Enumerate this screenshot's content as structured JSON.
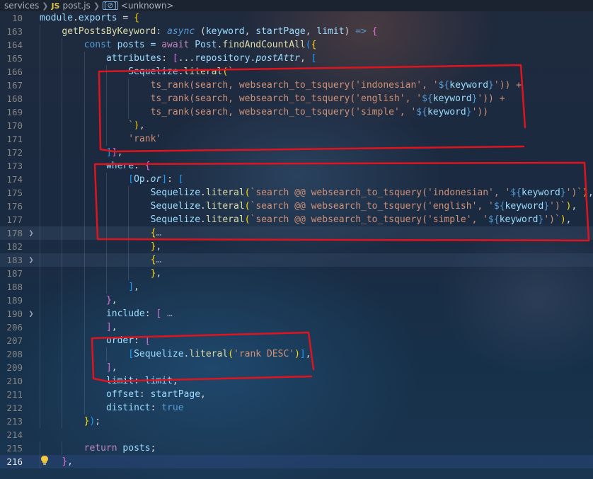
{
  "breadcrumb": {
    "folder": "services",
    "file_badge": "JS",
    "file": "post.js",
    "symbol_badge": "[⊘]",
    "symbol": "<unknown>"
  },
  "code_lines": [
    {
      "num": "10",
      "tokens": [
        {
          "t": "module",
          "c": "var"
        },
        {
          "t": ".",
          "c": "punc"
        },
        {
          "t": "exports",
          "c": "var"
        },
        {
          "t": " = ",
          "c": "punc"
        },
        {
          "t": "{",
          "c": "brk1"
        }
      ]
    },
    {
      "num": "163",
      "indent": 1,
      "tokens": [
        {
          "t": "getPostsByKeyword",
          "c": "fn"
        },
        {
          "t": ": ",
          "c": "punc"
        },
        {
          "t": "async",
          "c": "kwb it"
        },
        {
          "t": " (",
          "c": "punc"
        },
        {
          "t": "keyword",
          "c": "var"
        },
        {
          "t": ", ",
          "c": "punc"
        },
        {
          "t": "startPage",
          "c": "var"
        },
        {
          "t": ", ",
          "c": "punc"
        },
        {
          "t": "limit",
          "c": "var"
        },
        {
          "t": ") ",
          "c": "punc"
        },
        {
          "t": "=>",
          "c": "kwb"
        },
        {
          "t": " ",
          "c": "punc"
        },
        {
          "t": "{",
          "c": "brk2"
        }
      ]
    },
    {
      "num": "164",
      "indent": 2,
      "tokens": [
        {
          "t": "const",
          "c": "kwb"
        },
        {
          "t": " posts = ",
          "c": "var"
        },
        {
          "t": "await",
          "c": "kw"
        },
        {
          "t": " ",
          "c": "punc"
        },
        {
          "t": "Post",
          "c": "var"
        },
        {
          "t": ".",
          "c": "punc"
        },
        {
          "t": "findAndCountAll",
          "c": "fn"
        },
        {
          "t": "(",
          "c": "brk3"
        },
        {
          "t": "{",
          "c": "brk1"
        }
      ]
    },
    {
      "num": "165",
      "indent": 3,
      "tokens": [
        {
          "t": "attributes",
          "c": "prop"
        },
        {
          "t": ": ",
          "c": "punc"
        },
        {
          "t": "[",
          "c": "brk2"
        },
        {
          "t": "...",
          "c": "punc"
        },
        {
          "t": "repository",
          "c": "var"
        },
        {
          "t": ".",
          "c": "punc"
        },
        {
          "t": "postAttr",
          "c": "var it"
        },
        {
          "t": ", ",
          "c": "punc"
        },
        {
          "t": "[",
          "c": "brk3"
        }
      ]
    },
    {
      "num": "166",
      "indent": 4,
      "tokens": [
        {
          "t": "Sequelize",
          "c": "var"
        },
        {
          "t": ".",
          "c": "punc"
        },
        {
          "t": "literal",
          "c": "fn"
        },
        {
          "t": "(",
          "c": "brk1"
        },
        {
          "t": "`",
          "c": "tpl"
        }
      ]
    },
    {
      "num": "167",
      "indent": 5,
      "tokens": [
        {
          "t": "ts_rank(search, websearch_to_tsquery('indonesian', '",
          "c": "tpl"
        },
        {
          "t": "${",
          "c": "kwb"
        },
        {
          "t": "keyword",
          "c": "var"
        },
        {
          "t": "}",
          "c": "kwb"
        },
        {
          "t": "')) +",
          "c": "tpl"
        }
      ]
    },
    {
      "num": "168",
      "indent": 5,
      "tokens": [
        {
          "t": "ts_rank(search, websearch_to_tsquery('english', '",
          "c": "tpl"
        },
        {
          "t": "${",
          "c": "kwb"
        },
        {
          "t": "keyword",
          "c": "var"
        },
        {
          "t": "}",
          "c": "kwb"
        },
        {
          "t": "')) +",
          "c": "tpl"
        }
      ]
    },
    {
      "num": "169",
      "indent": 5,
      "tokens": [
        {
          "t": "ts_rank(search, websearch_to_tsquery('simple', '",
          "c": "tpl"
        },
        {
          "t": "${",
          "c": "kwb"
        },
        {
          "t": "keyword",
          "c": "var"
        },
        {
          "t": "}",
          "c": "kwb"
        },
        {
          "t": "'))",
          "c": "tpl"
        }
      ]
    },
    {
      "num": "170",
      "indent": 4,
      "tokens": [
        {
          "t": "`",
          "c": "tpl"
        },
        {
          "t": ")",
          "c": "brk1"
        },
        {
          "t": ",",
          "c": "punc"
        }
      ]
    },
    {
      "num": "171",
      "indent": 4,
      "tokens": [
        {
          "t": "'rank'",
          "c": "str"
        }
      ]
    },
    {
      "num": "172",
      "indent": 3,
      "tokens": [
        {
          "t": "]",
          "c": "brk3"
        },
        {
          "t": "]",
          "c": "brk2"
        },
        {
          "t": ",",
          "c": "punc"
        }
      ]
    },
    {
      "num": "173",
      "indent": 3,
      "tokens": [
        {
          "t": "where",
          "c": "prop"
        },
        {
          "t": ": ",
          "c": "punc"
        },
        {
          "t": "{",
          "c": "brk2"
        }
      ]
    },
    {
      "num": "174",
      "indent": 4,
      "tokens": [
        {
          "t": "[",
          "c": "brk3"
        },
        {
          "t": "Op",
          "c": "var"
        },
        {
          "t": ".",
          "c": "punc"
        },
        {
          "t": "or",
          "c": "var it"
        },
        {
          "t": "]",
          "c": "brk3"
        },
        {
          "t": ": ",
          "c": "punc"
        },
        {
          "t": "[",
          "c": "brk3"
        }
      ]
    },
    {
      "num": "175",
      "indent": 5,
      "tokens": [
        {
          "t": "Sequelize",
          "c": "var"
        },
        {
          "t": ".",
          "c": "punc"
        },
        {
          "t": "literal",
          "c": "fn"
        },
        {
          "t": "(",
          "c": "brk1"
        },
        {
          "t": "`search @@ websearch_to_tsquery('indonesian', '",
          "c": "tpl"
        },
        {
          "t": "${",
          "c": "kwb"
        },
        {
          "t": "keyword",
          "c": "var"
        },
        {
          "t": "}",
          "c": "kwb"
        },
        {
          "t": "')`",
          "c": "tpl"
        },
        {
          "t": ")",
          "c": "brk1"
        },
        {
          "t": ",",
          "c": "punc"
        }
      ]
    },
    {
      "num": "176",
      "indent": 5,
      "tokens": [
        {
          "t": "Sequelize",
          "c": "var"
        },
        {
          "t": ".",
          "c": "punc"
        },
        {
          "t": "literal",
          "c": "fn"
        },
        {
          "t": "(",
          "c": "brk1"
        },
        {
          "t": "`search @@ websearch_to_tsquery('english', '",
          "c": "tpl"
        },
        {
          "t": "${",
          "c": "kwb"
        },
        {
          "t": "keyword",
          "c": "var"
        },
        {
          "t": "}",
          "c": "kwb"
        },
        {
          "t": "')`",
          "c": "tpl"
        },
        {
          "t": ")",
          "c": "brk1"
        },
        {
          "t": ",",
          "c": "punc"
        }
      ]
    },
    {
      "num": "177",
      "indent": 5,
      "tokens": [
        {
          "t": "Sequelize",
          "c": "var"
        },
        {
          "t": ".",
          "c": "punc"
        },
        {
          "t": "literal",
          "c": "fn"
        },
        {
          "t": "(",
          "c": "brk1"
        },
        {
          "t": "`search @@ websearch_to_tsquery('simple', '",
          "c": "tpl"
        },
        {
          "t": "${",
          "c": "kwb"
        },
        {
          "t": "keyword",
          "c": "var"
        },
        {
          "t": "}",
          "c": "kwb"
        },
        {
          "t": "')`",
          "c": "tpl"
        },
        {
          "t": ")",
          "c": "brk1"
        },
        {
          "t": ",",
          "c": "punc"
        }
      ]
    },
    {
      "num": "178",
      "indent": 5,
      "fold": true,
      "highlight": true,
      "tokens": [
        {
          "t": "{",
          "c": "brk1"
        },
        {
          "t": "…",
          "c": "fold-ph"
        }
      ]
    },
    {
      "num": "182",
      "indent": 5,
      "tokens": [
        {
          "t": "}",
          "c": "brk1"
        },
        {
          "t": ",",
          "c": "punc"
        }
      ]
    },
    {
      "num": "183",
      "indent": 5,
      "fold": true,
      "highlight": true,
      "tokens": [
        {
          "t": "{",
          "c": "brk1"
        },
        {
          "t": "…",
          "c": "fold-ph"
        }
      ]
    },
    {
      "num": "187",
      "indent": 5,
      "tokens": [
        {
          "t": "}",
          "c": "brk1"
        },
        {
          "t": ",",
          "c": "punc"
        }
      ]
    },
    {
      "num": "188",
      "indent": 4,
      "tokens": [
        {
          "t": "]",
          "c": "brk3"
        },
        {
          "t": ",",
          "c": "punc"
        }
      ]
    },
    {
      "num": "189",
      "indent": 3,
      "tokens": [
        {
          "t": "}",
          "c": "brk2"
        },
        {
          "t": ",",
          "c": "punc"
        }
      ]
    },
    {
      "num": "190",
      "indent": 3,
      "fold": true,
      "tokens": [
        {
          "t": "include",
          "c": "prop"
        },
        {
          "t": ": ",
          "c": "punc"
        },
        {
          "t": "[",
          "c": "brk2"
        },
        {
          "t": " …",
          "c": "fold-ph"
        }
      ]
    },
    {
      "num": "206",
      "indent": 3,
      "tokens": [
        {
          "t": "]",
          "c": "brk2"
        },
        {
          "t": ",",
          "c": "punc"
        }
      ]
    },
    {
      "num": "207",
      "indent": 3,
      "tokens": [
        {
          "t": "order",
          "c": "prop"
        },
        {
          "t": ": ",
          "c": "punc"
        },
        {
          "t": "[",
          "c": "brk2"
        }
      ]
    },
    {
      "num": "208",
      "indent": 4,
      "tokens": [
        {
          "t": "[",
          "c": "brk3"
        },
        {
          "t": "Sequelize",
          "c": "var"
        },
        {
          "t": ".",
          "c": "punc"
        },
        {
          "t": "literal",
          "c": "fn"
        },
        {
          "t": "(",
          "c": "brk1"
        },
        {
          "t": "'rank DESC'",
          "c": "str"
        },
        {
          "t": ")",
          "c": "brk1"
        },
        {
          "t": "]",
          "c": "brk3"
        },
        {
          "t": ",",
          "c": "punc"
        }
      ]
    },
    {
      "num": "209",
      "indent": 3,
      "tokens": [
        {
          "t": "]",
          "c": "brk2"
        },
        {
          "t": ",",
          "c": "punc"
        }
      ]
    },
    {
      "num": "210",
      "indent": 3,
      "tokens": [
        {
          "t": "limit",
          "c": "prop"
        },
        {
          "t": ": ",
          "c": "punc"
        },
        {
          "t": "limit",
          "c": "var"
        },
        {
          "t": ",",
          "c": "punc"
        }
      ]
    },
    {
      "num": "211",
      "indent": 3,
      "tokens": [
        {
          "t": "offset",
          "c": "prop"
        },
        {
          "t": ": ",
          "c": "punc"
        },
        {
          "t": "startPage",
          "c": "var"
        },
        {
          "t": ",",
          "c": "punc"
        }
      ]
    },
    {
      "num": "212",
      "indent": 3,
      "tokens": [
        {
          "t": "distinct",
          "c": "prop"
        },
        {
          "t": ": ",
          "c": "punc"
        },
        {
          "t": "true",
          "c": "kwb"
        }
      ]
    },
    {
      "num": "213",
      "indent": 2,
      "tokens": [
        {
          "t": "}",
          "c": "brk1"
        },
        {
          "t": ")",
          "c": "brk3"
        },
        {
          "t": ";",
          "c": "punc"
        }
      ]
    },
    {
      "num": "214",
      "indent": 0,
      "tokens": []
    },
    {
      "num": "215",
      "indent": 2,
      "tokens": [
        {
          "t": "return",
          "c": "kw"
        },
        {
          "t": " ",
          "c": "punc"
        },
        {
          "t": "posts",
          "c": "var"
        },
        {
          "t": ";",
          "c": "punc"
        }
      ]
    },
    {
      "num": "216",
      "indent": 1,
      "current": true,
      "bulb": true,
      "tokens": [
        {
          "t": "}",
          "c": "brk2"
        },
        {
          "t": ",",
          "c": "punc"
        }
      ]
    }
  ],
  "colors": {
    "annotation": "#e0141e",
    "bulb": "#f2c744",
    "current_line_bg": "#28466f"
  }
}
